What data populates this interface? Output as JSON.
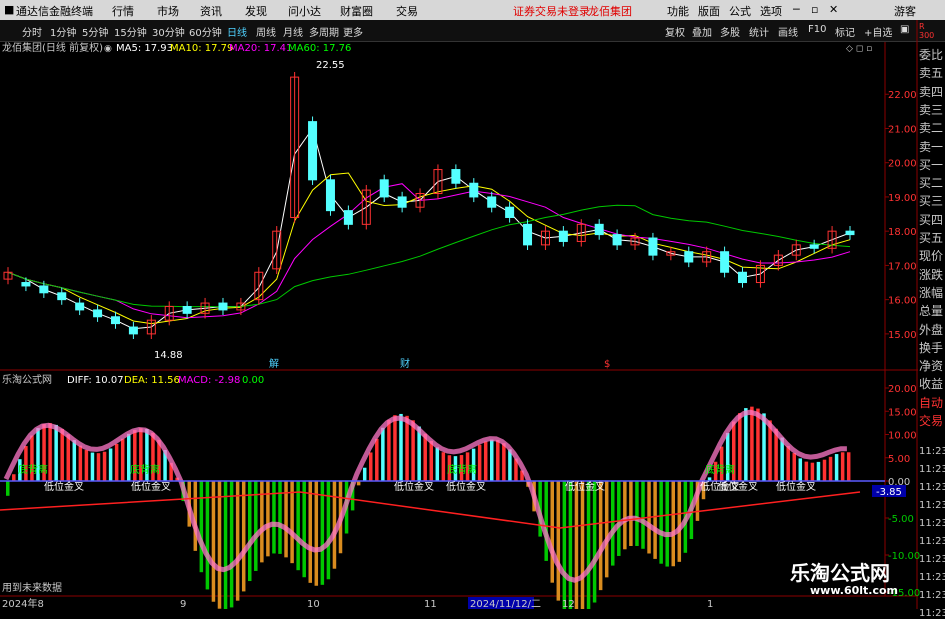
{
  "menubar": {
    "app_title": "通达信金融终端",
    "items": [
      "行情",
      "市场",
      "资讯",
      "发现",
      "问小达",
      "财富圈",
      "交易"
    ],
    "notice": "证券交易未登录",
    "stock_name": "龙佰集团",
    "right_items": [
      "功能",
      "版面",
      "公式",
      "选项"
    ],
    "guest": "游客"
  },
  "toolbar": {
    "periods": [
      "分时",
      "1分钟",
      "5分钟",
      "15分钟",
      "30分钟",
      "60分钟",
      "日线",
      "周线",
      "月线",
      "多周期",
      "更多"
    ],
    "active_period": "日线",
    "tools": [
      "复权",
      "叠加",
      "多股",
      "统计",
      "画线",
      "F10",
      "标记",
      "+自选"
    ]
  },
  "main_chart": {
    "title": "龙佰集团(日线 前复权)",
    "ma": [
      {
        "label": "MA5: 17.93",
        "color": "#ffffff"
      },
      {
        "label": "MA10: 17.79",
        "color": "#ffff00"
      },
      {
        "label": "MA20: 17.41",
        "color": "#ff00ff"
      },
      {
        "label": "MA60: 17.76",
        "color": "#00ff00"
      }
    ],
    "y_ticks": [
      "22.00",
      "21.00",
      "20.00",
      "19.00",
      "18.00",
      "17.00",
      "16.00",
      "15.00"
    ],
    "high_label": "22.55",
    "low_label": "14.88",
    "markers": [
      "解",
      "财",
      "$"
    ]
  },
  "sub_chart": {
    "title": "乐淘公式网",
    "values": [
      "DIFF: 10.07",
      "DEA: 11.56",
      "MACD: -2.98",
      "0.00"
    ],
    "y_ticks": [
      "20.00",
      "15.00",
      "10.00",
      "5.00",
      "0.00",
      "-5.00",
      "-10.00",
      "-15.00"
    ],
    "value_badge": "-3.85",
    "signal_labels": [
      "低位金叉",
      "低位金叉",
      "低位金叉",
      "低位金叉",
      "低位金叉",
      "低位金叉",
      "低位金叉",
      "低位金叉"
    ],
    "top_labels": [
      "底背离",
      "底背离",
      "底背离",
      "底背离"
    ],
    "footnote": "用到未来数据"
  },
  "date_axis": [
    "2024年8",
    "9",
    "10",
    "11",
    "2024/11/12/二",
    "12",
    "1"
  ],
  "right_panel": {
    "top": [
      "R",
      "300"
    ],
    "labels": [
      "委比",
      "卖五",
      "卖四",
      "卖三",
      "卖二",
      "卖一",
      "买一",
      "买二",
      "买三",
      "买四",
      "买五",
      "现价",
      "涨跌",
      "涨幅",
      "总量",
      "外盘",
      "换手",
      "净资",
      "收益",
      "自动",
      "交易"
    ],
    "times": [
      "11:23",
      "11:23",
      "11:23",
      "11:23",
      "11:23",
      "11:23",
      "11:23",
      "11:23",
      "11:23",
      "11:23"
    ]
  },
  "watermark": {
    "cn": "乐淘公式网",
    "url": "www.60lt.com"
  },
  "colors": {
    "up": "#ff3232",
    "down": "#54ffff",
    "ma5": "#ffffff",
    "ma10": "#ffff00",
    "ma20": "#ff00ff",
    "ma60": "#00c800"
  },
  "chart_data": {
    "type": "candlestick",
    "ylim": [
      14.5,
      23
    ],
    "points": [
      [
        "2024-08-01",
        16.6,
        16.8
      ],
      [
        "2024-08-05",
        16.5,
        16.4
      ],
      [
        "2024-08-08",
        16.4,
        16.2
      ],
      [
        "2024-08-12",
        16.2,
        16.0
      ],
      [
        "2024-08-15",
        15.9,
        15.7
      ],
      [
        "2024-08-19",
        15.7,
        15.5
      ],
      [
        "2024-08-22",
        15.5,
        15.3
      ],
      [
        "2024-08-26",
        15.2,
        15.0
      ],
      [
        "2024-08-29",
        15.0,
        15.4
      ],
      [
        "2024-09-02",
        15.4,
        15.8
      ],
      [
        "2024-09-05",
        15.8,
        15.6
      ],
      [
        "2024-09-09",
        15.6,
        15.9
      ],
      [
        "2024-09-12",
        15.9,
        15.7
      ],
      [
        "2024-09-19",
        15.7,
        15.9
      ],
      [
        "2024-09-24",
        16.0,
        16.8
      ],
      [
        "2024-09-26",
        16.9,
        18.0
      ],
      [
        "2024-09-30",
        18.4,
        22.5
      ],
      [
        "2024-10-08",
        21.2,
        19.5
      ],
      [
        "2024-10-10",
        19.5,
        18.6
      ],
      [
        "2024-10-14",
        18.6,
        18.2
      ],
      [
        "2024-10-17",
        18.2,
        19.2
      ],
      [
        "2024-10-21",
        19.5,
        19.0
      ],
      [
        "2024-10-24",
        19.0,
        18.7
      ],
      [
        "2024-10-28",
        18.7,
        19.1
      ],
      [
        "2024-10-31",
        19.1,
        19.8
      ],
      [
        "2024-11-04",
        19.8,
        19.4
      ],
      [
        "2024-11-07",
        19.4,
        19.0
      ],
      [
        "2024-11-11",
        19.0,
        18.7
      ],
      [
        "2024-11-14",
        18.7,
        18.4
      ],
      [
        "2024-11-18",
        18.2,
        17.6
      ],
      [
        "2024-11-21",
        17.6,
        18.0
      ],
      [
        "2024-11-25",
        18.0,
        17.7
      ],
      [
        "2024-11-28",
        17.7,
        18.2
      ],
      [
        "2024-12-02",
        18.2,
        17.9
      ],
      [
        "2024-12-05",
        17.9,
        17.6
      ],
      [
        "2024-12-09",
        17.6,
        17.8
      ],
      [
        "2024-12-12",
        17.8,
        17.3
      ],
      [
        "2024-12-16",
        17.3,
        17.4
      ],
      [
        "2024-12-19",
        17.4,
        17.1
      ],
      [
        "2024-12-23",
        17.1,
        17.4
      ],
      [
        "2024-12-26",
        17.4,
        16.8
      ],
      [
        "2024-12-30",
        16.8,
        16.5
      ],
      [
        "2025-01-03",
        16.5,
        17.0
      ],
      [
        "2025-01-07",
        17.0,
        17.3
      ],
      [
        "2025-01-10",
        17.3,
        17.6
      ],
      [
        "2025-01-14",
        17.6,
        17.5
      ],
      [
        "2025-01-17",
        17.5,
        18.0
      ],
      [
        "2025-01-21",
        18.0,
        17.9
      ]
    ]
  }
}
